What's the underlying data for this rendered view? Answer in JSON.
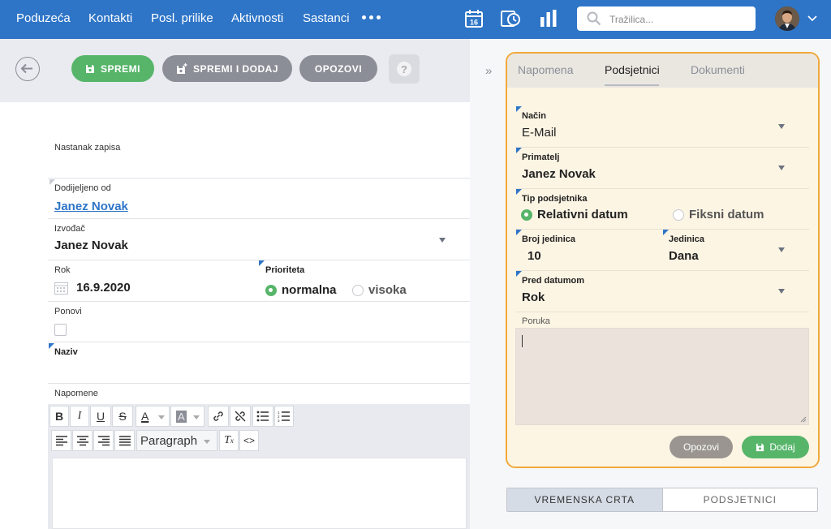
{
  "nav": {
    "items": [
      "Poduzeća",
      "Kontakti",
      "Posl. prilike",
      "Aktivnosti",
      "Sastanci"
    ],
    "calendar_day": "16",
    "search_placeholder": "Tražilica..."
  },
  "toolbar": {
    "save": "SPREMI",
    "save_add": "SPREMI I DODAJ",
    "cancel": "OPOZOVI",
    "help": "?"
  },
  "form": {
    "created_label": "Nastanak zapisa",
    "assigned_by_label": "Dodijeljeno od",
    "assigned_by_value": "Janez Novak",
    "performer_label": "Izvođač",
    "performer_value": "Janez Novak",
    "deadline_label": "Rok",
    "deadline_value": "16.9.2020",
    "priority_label": "Prioriteta",
    "priority_options": [
      "normalna",
      "visoka"
    ],
    "priority_selected": "normalna",
    "repeat_label": "Ponovi",
    "title_label": "Naziv",
    "notes_label": "Napomene"
  },
  "editor": {
    "paragraph_select": "Paragraph"
  },
  "panel": {
    "tabs": [
      "Napomena",
      "Podsjetnici",
      "Dokumenti"
    ],
    "active_tab": "Podsjetnici",
    "method_label": "Način",
    "method_value": "E-Mail",
    "recipient_label": "Primatelj",
    "recipient_value": "Janez Novak",
    "reminder_type_label": "Tip podsjetnika",
    "reminder_type_options": [
      "Relativni datum",
      "Fiksni datum"
    ],
    "reminder_type_selected": "Relativni datum",
    "units_count_label": "Broj jedinica",
    "units_count_value": "10",
    "unit_label": "Jedinica",
    "unit_value": "Dana",
    "before_date_label": "Pred datumom",
    "before_date_value": "Rok",
    "message_label": "Poruka",
    "cancel": "Opozovi",
    "add": "Dodaj"
  },
  "bottom_toggle": {
    "timeline": "VREMENSKA CRTA",
    "reminders": "PODSJETNICI",
    "active": "VREMENSKA CRTA"
  },
  "colors": {
    "nav_blue": "#2e75c7",
    "green": "#57b56a",
    "gray_button": "#8b8e96",
    "panel_border": "#f0a93a",
    "panel_bg": "#fdf5e4"
  }
}
